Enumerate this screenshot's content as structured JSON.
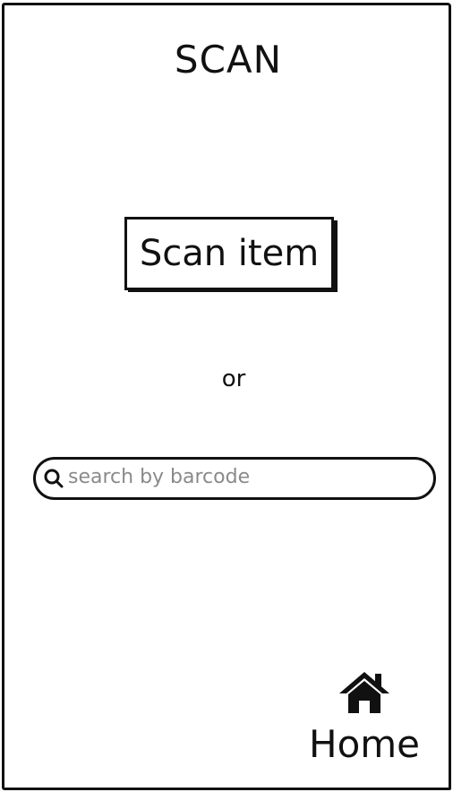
{
  "header": {
    "title": "SCAN"
  },
  "main": {
    "scan_button_label": "Scan item",
    "separator_text": "or",
    "search": {
      "placeholder": "search by barcode",
      "value": "",
      "icon": "search-icon"
    }
  },
  "footer": {
    "home_label": "Home",
    "home_icon": "home-icon"
  }
}
